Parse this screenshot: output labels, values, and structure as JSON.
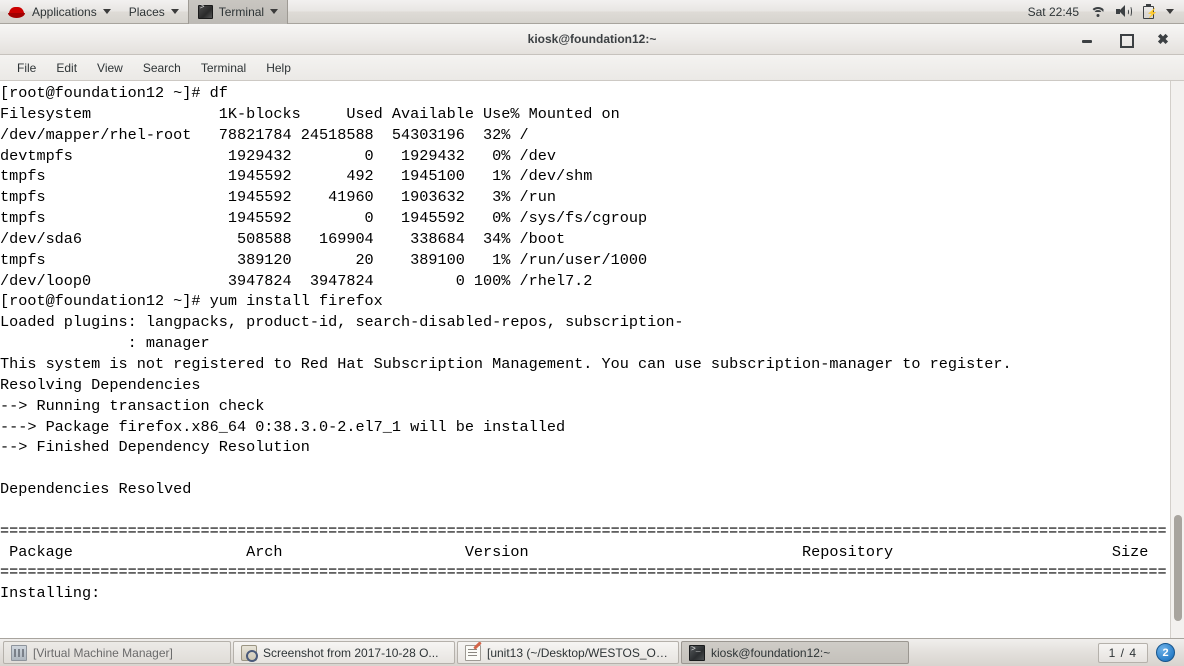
{
  "top_panel": {
    "logo_icon": "redhat-logo-icon",
    "menus": [
      {
        "label": "Applications",
        "icon": "redhat-logo-icon",
        "active": false
      },
      {
        "label": "Places",
        "icon": null,
        "active": false
      },
      {
        "label": "Terminal",
        "icon": "terminal-icon",
        "active": true
      }
    ],
    "clock": "Sat 22:45",
    "tray_icons": [
      "wifi-icon",
      "volume-icon",
      "battery-icon",
      "chevron-down-icon"
    ]
  },
  "window": {
    "title": "kiosk@foundation12:~",
    "controls": {
      "minimize": "minimize-icon",
      "maximize": "maximize-icon",
      "close": "close-icon"
    },
    "menubar": [
      "File",
      "Edit",
      "View",
      "Search",
      "Terminal",
      "Help"
    ]
  },
  "terminal": {
    "lines": [
      "[root@foundation12 ~]# df",
      "Filesystem              1K-blocks     Used Available Use% Mounted on",
      "/dev/mapper/rhel-root   78821784 24518588  54303196  32% /",
      "devtmpfs                 1929432        0   1929432   0% /dev",
      "tmpfs                    1945592      492   1945100   1% /dev/shm",
      "tmpfs                    1945592    41960   1903632   3% /run",
      "tmpfs                    1945592        0   1945592   0% /sys/fs/cgroup",
      "/dev/sda6                 508588   169904    338684  34% /boot",
      "tmpfs                     389120       20    389100   1% /run/user/1000",
      "/dev/loop0               3947824  3947824         0 100% /rhel7.2",
      "[root@foundation12 ~]# yum install firefox",
      "Loaded plugins: langpacks, product-id, search-disabled-repos, subscription-",
      "              : manager",
      "This system is not registered to Red Hat Subscription Management. You can use subscription-manager to register.",
      "Resolving Dependencies",
      "--> Running transaction check",
      "---> Package firefox.x86_64 0:38.3.0-2.el7_1 will be installed",
      "--> Finished Dependency Resolution",
      "",
      "Dependencies Resolved",
      "",
      "================================================================================================================================",
      " Package                   Arch                    Version                              Repository                        Size",
      "================================================================================================================================",
      "Installing:"
    ],
    "scrollbar": "vertical-scrollbar"
  },
  "taskbar": {
    "items": [
      {
        "label": "[Virtual Machine Manager]",
        "icon": "virtual-machine-manager-icon",
        "active": false
      },
      {
        "label": "Screenshot from 2017-10-28 O...",
        "icon": "screenshot-icon",
        "active": false
      },
      {
        "label": "[unit13 (~/Desktop/WESTOS_OS...",
        "icon": "text-editor-icon",
        "active": false
      },
      {
        "label": "kiosk@foundation12:~",
        "icon": "terminal-icon",
        "active": true
      }
    ],
    "workspace": "1 / 4",
    "notification_count": "2"
  },
  "colors": {
    "terminal_bg": "#ffffff",
    "terminal_fg": "#000000",
    "panel_bg": "#e8e6e3",
    "accent": "#cc0000",
    "badge": "#2a7fc9"
  }
}
